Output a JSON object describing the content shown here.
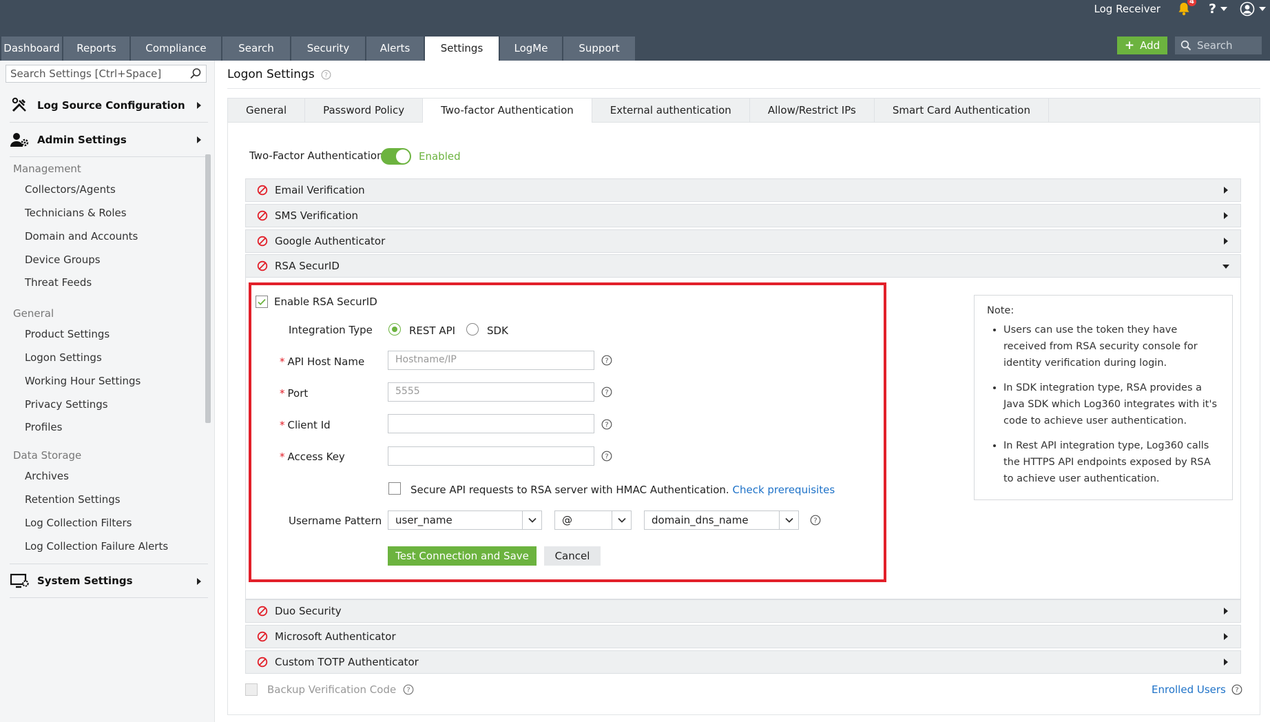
{
  "topbar": {
    "log_receiver": "Log Receiver",
    "notification_count": "4",
    "help": "?",
    "add_label": "Add",
    "search_placeholder": "Search",
    "tabs": [
      {
        "label": "Dashboard"
      },
      {
        "label": "Reports"
      },
      {
        "label": "Compliance"
      },
      {
        "label": "Search"
      },
      {
        "label": "Security"
      },
      {
        "label": "Alerts"
      },
      {
        "label": "Settings"
      },
      {
        "label": "LogMe"
      },
      {
        "label": "Support"
      }
    ],
    "active_tab": "Settings"
  },
  "sidebar": {
    "search_placeholder": "Search Settings [Ctrl+Space]",
    "log_source": "Log Source Configuration",
    "admin_settings": "Admin Settings",
    "system_settings": "System Settings",
    "sections": [
      {
        "heading": "Management",
        "items": [
          "Collectors/Agents",
          "Technicians & Roles",
          "Domain and Accounts",
          "Device Groups",
          "Threat Feeds"
        ]
      },
      {
        "heading": "General",
        "items": [
          "Product Settings",
          "Logon Settings",
          "Working Hour Settings",
          "Privacy Settings",
          "Profiles"
        ]
      },
      {
        "heading": "Data Storage",
        "items": [
          "Archives",
          "Retention Settings",
          "Log Collection Filters",
          "Log Collection Failure Alerts"
        ]
      }
    ]
  },
  "page": {
    "title": "Logon Settings",
    "subtabs": [
      "General",
      "Password Policy",
      "Two-factor Authentication",
      "External authentication",
      "Allow/Restrict IPs",
      "Smart Card Authentication"
    ],
    "active_subtab": "Two-factor Authentication",
    "tfa_label": "Two-Factor Authentication",
    "tfa_status": "Enabled",
    "methods": [
      "Email Verification",
      "SMS Verification",
      "Google Authenticator",
      "RSA SecurID",
      "Duo Security",
      "Microsoft Authenticator",
      "Custom TOTP Authenticator"
    ],
    "expanded_method": "RSA SecurID"
  },
  "rsa": {
    "enable_label": "Enable RSA SecurID",
    "integration_type_label": "Integration Type",
    "option_rest": "REST API",
    "option_sdk": "SDK",
    "selected_option": "REST API",
    "api_host_label": "API Host Name",
    "api_host_placeholder": "Hostname/IP",
    "port_label": "Port",
    "port_placeholder": "5555",
    "client_id_label": "Client Id",
    "access_key_label": "Access Key",
    "hmac_text": "Secure API requests to RSA server with HMAC Authentication.",
    "hmac_link": "Check prerequisites",
    "username_pattern_label": "Username Pattern",
    "pattern_user": "user_name",
    "pattern_sep": "@",
    "pattern_domain": "domain_dns_name",
    "test_button": "Test Connection and Save",
    "cancel_button": "Cancel"
  },
  "note": {
    "title": "Note:",
    "items": [
      "Users can use the token they have received from RSA security console for identity verification during login.",
      "In SDK integration type, RSA provides a Java SDK which Log360 integrates with it's code to achieve user authentication.",
      "In Rest API integration type, Log360 calls the HTTPS API endpoints exposed by RSA to achieve user authentication."
    ]
  },
  "footer": {
    "backup_label": "Backup Verification Code",
    "enrolled_users": "Enrolled Users"
  },
  "colors": {
    "topbar": "#404d5b",
    "accent_green": "#6cb33f",
    "highlight_red": "#e2202a",
    "link_blue": "#1e72c8"
  }
}
